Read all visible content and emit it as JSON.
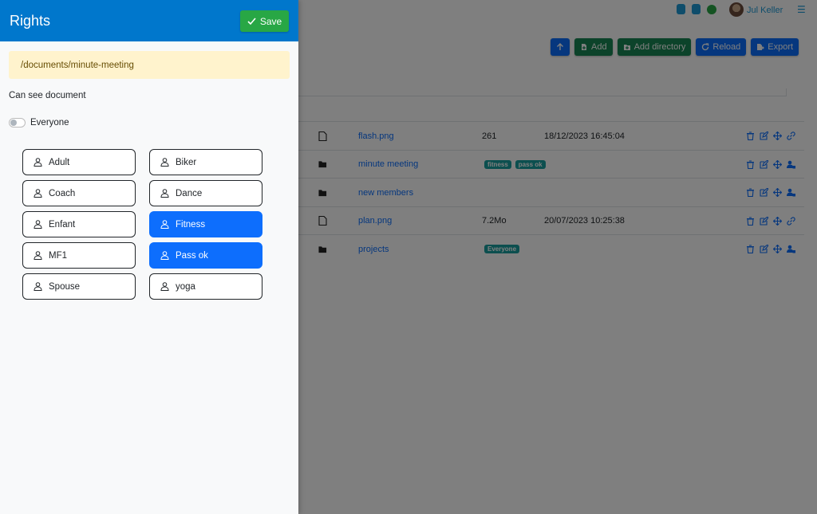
{
  "topbar": {
    "username": "Jul Keller",
    "icon_colors": [
      "#1e9bd7",
      "#1e9bd7",
      "#28a745"
    ]
  },
  "toolbar": {
    "up_label": "",
    "add_label": "Add",
    "add_directory_label": "Add directory",
    "reload_label": "Reload",
    "export_label": "Export"
  },
  "files": [
    {
      "type": "file-icon",
      "name": "flash.png",
      "size": "261",
      "date": "18/12/2023 16:45:04",
      "tags": []
    },
    {
      "type": "folder-icon",
      "name": "minute meeting",
      "size": "",
      "date": "",
      "tags": [
        "fitness",
        "pass ok"
      ]
    },
    {
      "type": "folder-icon",
      "name": "new members",
      "size": "",
      "date": "",
      "tags": []
    },
    {
      "type": "file-icon",
      "name": "plan.png",
      "size": "7.2Mo",
      "date": "20/07/2023 10:25:38",
      "tags": []
    },
    {
      "type": "folder-icon",
      "name": "projects",
      "size": "",
      "date": "",
      "tags": [
        "Everyone"
      ]
    }
  ],
  "rights": {
    "title": "Rights",
    "save_label": "Save",
    "path": "/documents/minute-meeting",
    "can_see_label": "Can see document",
    "everyone_label": "Everyone",
    "everyone_enabled": false,
    "groups": [
      {
        "label": "Adult",
        "selected": false
      },
      {
        "label": "Biker",
        "selected": false
      },
      {
        "label": "Coach",
        "selected": false
      },
      {
        "label": "Dance",
        "selected": false
      },
      {
        "label": "Enfant",
        "selected": false
      },
      {
        "label": "Fitness",
        "selected": true
      },
      {
        "label": "MF1",
        "selected": false
      },
      {
        "label": "Pass ok",
        "selected": true
      },
      {
        "label": "Spouse",
        "selected": false
      },
      {
        "label": "yoga",
        "selected": false
      }
    ]
  },
  "colors": {
    "header": "#0077cc",
    "save": "#28a745",
    "selected": "#0d6efd",
    "path_bg": "#fff3cd",
    "tag": "#199e9e"
  }
}
